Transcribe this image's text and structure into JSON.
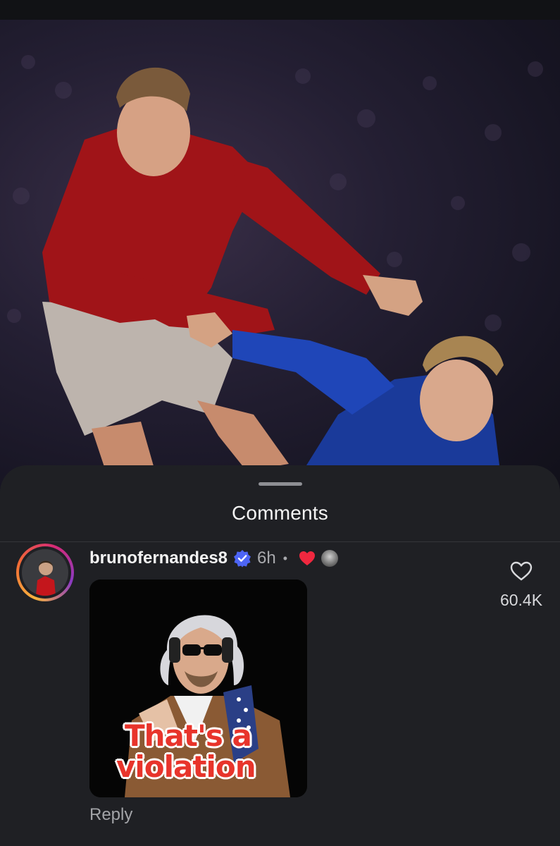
{
  "sheet": {
    "title": "Comments"
  },
  "comment": {
    "username": "brunofernandes8",
    "time": "6h",
    "separator": "•",
    "like_count": "60.4K",
    "reply_label": "Reply",
    "gif_caption_line1": "That's a",
    "gif_caption_line2": "violation"
  },
  "colors": {
    "sheet_bg": "#1f2024",
    "verified_blue": "#4d65f5",
    "heart_red": "#f0283f",
    "gif_text_red": "#e8342b"
  },
  "icons": {
    "verified": "verified-badge-icon",
    "creator_heart": "heart-filled-icon",
    "like": "heart-outline-icon"
  }
}
